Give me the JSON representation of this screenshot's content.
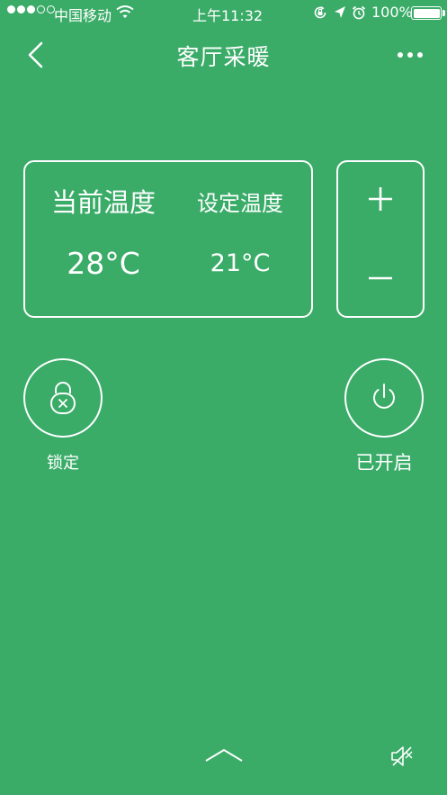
{
  "status_bar": {
    "carrier": "中国移动",
    "time": "上午11:32",
    "battery": "100%"
  },
  "nav": {
    "title": "客厅采暖"
  },
  "temperature": {
    "current_label": "当前温度",
    "current_value": "28°C",
    "set_label": "设定温度",
    "set_value": "21°C"
  },
  "controls": {
    "lock_label": "锁定",
    "power_label": "已开启"
  },
  "colors": {
    "background": "#3aac68",
    "foreground": "#ffffff"
  },
  "icons": {
    "back": "chevron-left-icon",
    "more": "more-dots-icon",
    "plus": "plus-icon",
    "minus": "minus-icon",
    "lock": "lock-icon",
    "power": "power-icon",
    "expand": "chevron-up-icon",
    "mute": "speaker-muted-icon"
  }
}
